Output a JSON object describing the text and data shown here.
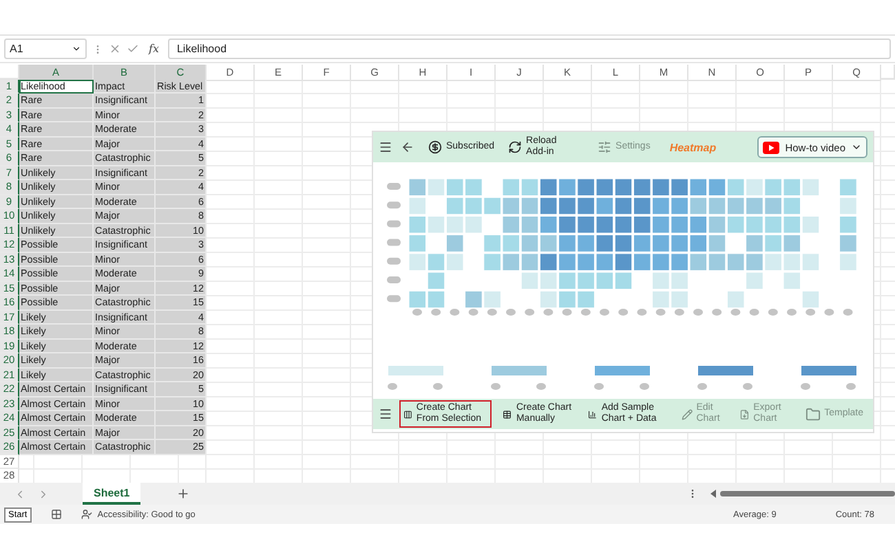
{
  "formula_bar": {
    "name_box": "A1",
    "function_label": "fx",
    "value": "Likelihood"
  },
  "columns": [
    {
      "label": "A",
      "selected": true
    },
    {
      "label": "B",
      "selected": true
    },
    {
      "label": "C",
      "selected": true
    },
    {
      "label": "D",
      "selected": false
    },
    {
      "label": "E",
      "selected": false
    },
    {
      "label": "F",
      "selected": false
    },
    {
      "label": "G",
      "selected": false
    },
    {
      "label": "H",
      "selected": false
    },
    {
      "label": "I",
      "selected": false
    },
    {
      "label": "J",
      "selected": false
    },
    {
      "label": "K",
      "selected": false
    },
    {
      "label": "L",
      "selected": false
    },
    {
      "label": "M",
      "selected": false
    },
    {
      "label": "N",
      "selected": false
    },
    {
      "label": "O",
      "selected": false
    },
    {
      "label": "P",
      "selected": false
    },
    {
      "label": "Q",
      "selected": false
    }
  ],
  "rows": [
    {
      "number": "1",
      "selected": true,
      "active": true,
      "cells": [
        "Likelihood",
        "Impact",
        "Risk Level"
      ]
    },
    {
      "number": "2",
      "selected": true,
      "active": false,
      "cells": [
        "Rare",
        "Insignificant",
        "1"
      ]
    },
    {
      "number": "3",
      "selected": true,
      "active": false,
      "cells": [
        "Rare",
        "Minor",
        "2"
      ]
    },
    {
      "number": "4",
      "selected": true,
      "active": false,
      "cells": [
        "Rare",
        "Moderate",
        "3"
      ]
    },
    {
      "number": "5",
      "selected": true,
      "active": false,
      "cells": [
        "Rare",
        "Major",
        "4"
      ]
    },
    {
      "number": "6",
      "selected": true,
      "active": false,
      "cells": [
        "Rare",
        "Catastrophic",
        "5"
      ]
    },
    {
      "number": "7",
      "selected": true,
      "active": false,
      "cells": [
        "Unlikely",
        "Insignificant",
        "2"
      ]
    },
    {
      "number": "8",
      "selected": true,
      "active": false,
      "cells": [
        "Unlikely",
        "Minor",
        "4"
      ]
    },
    {
      "number": "9",
      "selected": true,
      "active": false,
      "cells": [
        "Unlikely",
        "Moderate",
        "6"
      ]
    },
    {
      "number": "10",
      "selected": true,
      "active": false,
      "cells": [
        "Unlikely",
        "Major",
        "8"
      ]
    },
    {
      "number": "11",
      "selected": true,
      "active": false,
      "cells": [
        "Unlikely",
        "Catastrophic",
        "10"
      ]
    },
    {
      "number": "12",
      "selected": true,
      "active": false,
      "cells": [
        "Possible",
        "Insignificant",
        "3"
      ]
    },
    {
      "number": "13",
      "selected": true,
      "active": false,
      "cells": [
        "Possible",
        "Minor",
        "6"
      ]
    },
    {
      "number": "14",
      "selected": true,
      "active": false,
      "cells": [
        "Possible",
        "Moderate",
        "9"
      ]
    },
    {
      "number": "15",
      "selected": true,
      "active": false,
      "cells": [
        "Possible",
        "Major",
        "12"
      ]
    },
    {
      "number": "16",
      "selected": true,
      "active": false,
      "cells": [
        "Possible",
        "Catastrophic",
        "15"
      ]
    },
    {
      "number": "17",
      "selected": true,
      "active": false,
      "cells": [
        "Likely",
        "Insignificant",
        "4"
      ]
    },
    {
      "number": "18",
      "selected": true,
      "active": false,
      "cells": [
        "Likely",
        "Minor",
        "8"
      ]
    },
    {
      "number": "19",
      "selected": true,
      "active": false,
      "cells": [
        "Likely",
        "Moderate",
        "12"
      ]
    },
    {
      "number": "20",
      "selected": true,
      "active": false,
      "cells": [
        "Likely",
        "Major",
        "16"
      ]
    },
    {
      "number": "21",
      "selected": true,
      "active": false,
      "cells": [
        "Likely",
        "Catastrophic",
        "20"
      ]
    },
    {
      "number": "22",
      "selected": true,
      "active": false,
      "cells": [
        "Almost Certain",
        "Insignificant",
        "5"
      ]
    },
    {
      "number": "23",
      "selected": true,
      "active": false,
      "cells": [
        "Almost Certain",
        "Minor",
        "10"
      ]
    },
    {
      "number": "24",
      "selected": true,
      "active": false,
      "cells": [
        "Almost Certain",
        "Moderate",
        "15"
      ]
    },
    {
      "number": "25",
      "selected": true,
      "active": false,
      "cells": [
        "Almost Certain",
        "Major",
        "20"
      ]
    },
    {
      "number": "26",
      "selected": true,
      "active": false,
      "cells": [
        "Almost Certain",
        "Catastrophic",
        "25"
      ]
    },
    {
      "number": "27",
      "selected": false
    },
    {
      "number": "28",
      "selected": false
    }
  ],
  "addin": {
    "header": {
      "items": [
        {
          "kind": "subscribed",
          "label": "Subscribed",
          "disabled": false
        },
        {
          "kind": "reload",
          "label": "Reload Add-in",
          "disabled": false
        },
        {
          "kind": "settings",
          "label": "Settings",
          "disabled": true
        }
      ],
      "title": "Heatmap",
      "video_button": "How-to video"
    },
    "toolbar": [
      {
        "kind": "selection",
        "label": "Create Chart From Selection",
        "selected": true,
        "disabled": false
      },
      {
        "kind": "manual",
        "label": "Create Chart Manually",
        "selected": false,
        "disabled": false
      },
      {
        "kind": "sample",
        "label": "Add Sample Chart + Data",
        "selected": false,
        "disabled": false
      },
      {
        "kind": "edit",
        "label": "Edit Chart",
        "selected": false,
        "disabled": true
      },
      {
        "kind": "export",
        "label": "Export Chart",
        "selected": false,
        "disabled": true
      },
      {
        "kind": "template",
        "label": "Template",
        "selected": false,
        "disabled": true
      }
    ]
  },
  "sheet_tabs": [
    {
      "label": "Sheet1",
      "selected": true
    }
  ],
  "status_bar": {
    "start": "Start",
    "accessibility": "Accessibility: Good to go",
    "average": "Average: 9",
    "count": "Count: 78"
  }
}
